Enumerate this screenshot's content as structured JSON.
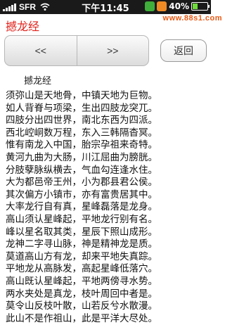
{
  "status_bar": {
    "carrier": "SFR",
    "time": "下午11:45",
    "battery_percent": "40%",
    "battery_level": 0.4,
    "icons": [
      "signal-icon",
      "wifi-icon",
      "app-icon-green",
      "app-icon-orange",
      "battery-icon"
    ]
  },
  "watermark": "www.88s1.com",
  "header": {
    "title": "撼龙经"
  },
  "nav": {
    "prev_label": "<<",
    "next_label": ">>"
  },
  "back_label": "返回",
  "article": {
    "heading": "撼龙经",
    "lines": [
      "须弥山是天地骨，中镇天地为巨物。",
      "如人背脊与项梁，生出四肢龙突兀。",
      "四肢分出四世界，南北东西为四派。",
      "西北崆峒数万程，东入三韩隔杳冥。",
      "惟有南龙入中国，胎宗孕祖来奇特。",
      "黄河九曲为大肠，川江屈曲为膀胱。",
      "分肢孽脉纵横去，气血勾连逢水住。",
      "大为都邑帝王州，小为郡县君公侯。",
      "其次偏方小镇市，亦有富贵居其中。",
      "大率龙行自有真，星峰磊落是龙身。",
      "高山须认星峰起，平地龙行别有名。",
      "峰以星名取其类，星辰下照山成形。",
      "龙神二字寻山脉，神是精神龙是质。",
      "莫道高山方有龙，却来平地失真踪。",
      "平地龙从高脉发，高起星峰低落穴。",
      "高山既认星峰起，平地两傍寻水势。",
      "两水夹处是真龙，枝叶周回中者是。",
      "莫令山反枝叶散，山若反兮水散漫。",
      "此山不是作祖山，此是平洋大尽处。"
    ]
  }
}
